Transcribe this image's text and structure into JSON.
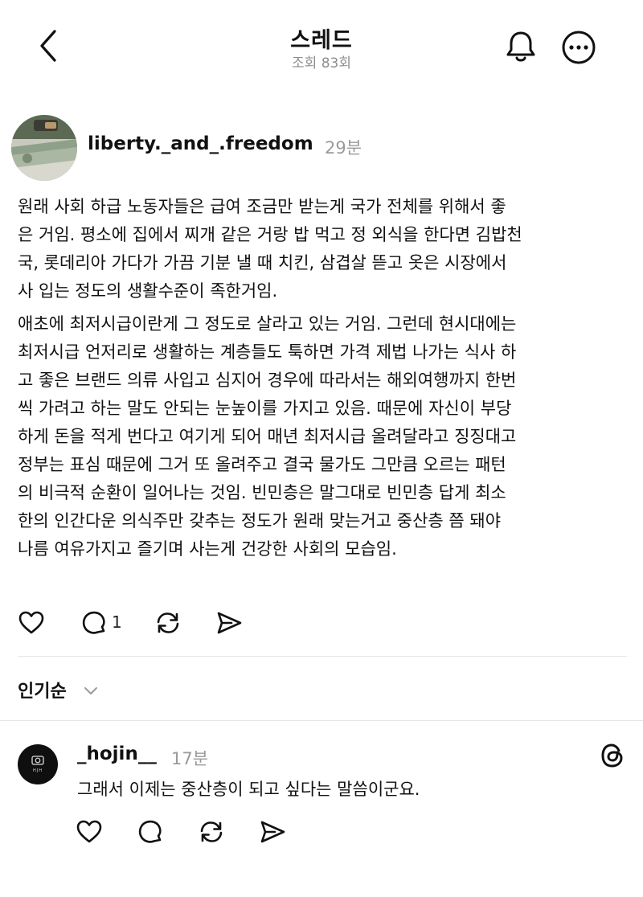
{
  "header": {
    "title": "스레드",
    "views": "조회 83회"
  },
  "post": {
    "username": "liberty._and_.freedom",
    "time": "29분",
    "paragraphs": [
      [
        "원래 사회 하급 노동자들은 급여 조금만 받는게 국가 전체를 위해서 좋",
        "은 거임. 평소에 집에서 찌개 같은 거랑 밥 먹고 정 외식을 한다면 김밥천",
        "국, 롯데리아 가다가 가끔 기분 낼 때 치킨, 삼겹살 뜯고 옷은 시장에서",
        "사 입는 정도의 생활수준이 족한거임."
      ],
      [
        "애초에 최저시급이란게 그 정도로 살라고 있는 거임. 그런데 현시대에는",
        "최저시급 언저리로 생활하는 계층들도 툭하면 가격 제법 나가는 식사 하",
        "고 좋은 브랜드 의류 사입고 심지어 경우에 따라서는 해외여행까지 한번",
        "씩 가려고 하는 말도 안되는 눈높이를 가지고 있음. 때문에 자신이 부당",
        "하게 돈을 적게 번다고 여기게 되어 매년 최저시급 올려달라고 징징대고",
        "정부는 표심 때문에 그거 또 올려주고 결국 물가도 그만큼 오르는 패턴",
        "의 비극적 순환이 일어나는 것임. 빈민층은 말그대로 빈민층 답게 최소",
        "한의 인간다운 의식주만 갖추는 정도가 원래 맞는거고 중산층 쯤 돼야",
        "나름 여유가지고 즐기며 사는게 건강한 사회의 모습임."
      ]
    ],
    "reply_count": "1"
  },
  "sort": {
    "label": "인기순"
  },
  "comment": {
    "username": "_hojin__",
    "time": "17분",
    "text": "그래서 이제는 중산층이 되고 싶다는 말씀이군요.",
    "avatar_text": "HJH"
  },
  "icons": {
    "back": "chevron-left-icon",
    "bell": "bell-icon",
    "more": "more-horizontal-icon",
    "like": "heart-icon",
    "reply": "comment-bubble-icon",
    "repost": "repost-icon",
    "share": "send-icon",
    "threads": "threads-logo-icon"
  }
}
